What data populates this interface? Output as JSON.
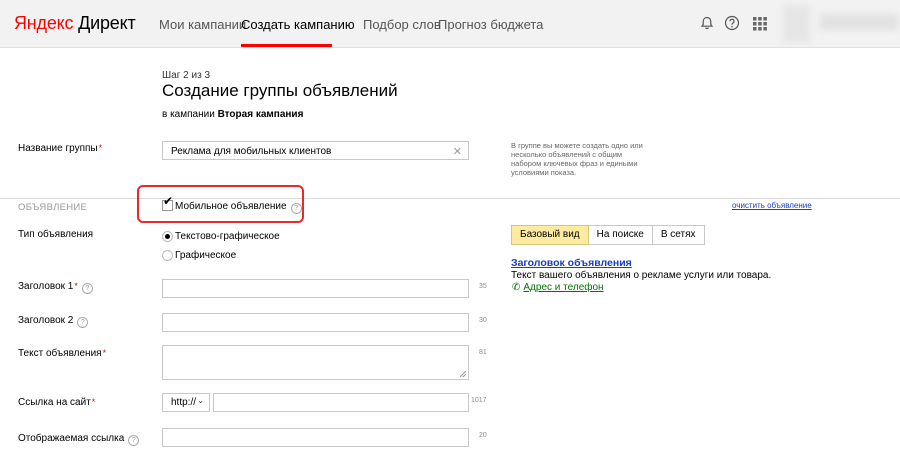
{
  "header": {
    "logo_part1": "Яндекс",
    "logo_part2": " Директ",
    "nav": [
      {
        "label": "Мои кампании"
      },
      {
        "label": "Создать кампанию"
      },
      {
        "label": "Подбор слов"
      },
      {
        "label": "Прогноз бюджета"
      }
    ],
    "active_nav": "Создать кампанию",
    "accent_color": "#ff0000",
    "icons": [
      "bell-icon",
      "help-icon",
      "apps-grid-icon"
    ]
  },
  "page": {
    "step": "Шаг 2 из 3",
    "title": "Создание группы объявлений",
    "campaign_prefix": "в кампании ",
    "campaign_name": "Вторая кампания"
  },
  "group": {
    "label": "Название группы",
    "required_mark": "*",
    "value": "Реклама для мобильных клиентов",
    "hint": "В группе вы можете создать одно или несколько объявлений с общим набором ключевых фраз и едиными условиями показа."
  },
  "ad": {
    "section_title": "ОБЪЯВЛЕНИЕ",
    "mobile_label": "Мобильное объявление",
    "mobile_checked": true,
    "clear_link": "очистить объявление",
    "type_label": "Тип объявления",
    "type_options": [
      "Текстово-графическое",
      "Графическое"
    ],
    "type_selected": "Текстово-графическое",
    "fields": {
      "title1": {
        "label": "Заголовок 1",
        "required": "*",
        "counter": "35"
      },
      "title2": {
        "label": "Заголовок 2",
        "counter": "30"
      },
      "text": {
        "label": "Текст объявления",
        "required": "*",
        "counter": "81"
      },
      "url": {
        "label": "Ссылка на сайт",
        "required": "*",
        "protocol": "http://",
        "counter": "1017"
      },
      "display_url": {
        "label": "Отображаемая ссылка",
        "counter": "20"
      }
    }
  },
  "preview": {
    "tabs": [
      "Базовый вид",
      "На поиске",
      "В сетях"
    ],
    "active_tab": "Базовый вид",
    "title": "Заголовок объявления",
    "text": "Текст вашего объявления о рекламе услуги или товара.",
    "contact_link": "Адрес и телефон"
  }
}
